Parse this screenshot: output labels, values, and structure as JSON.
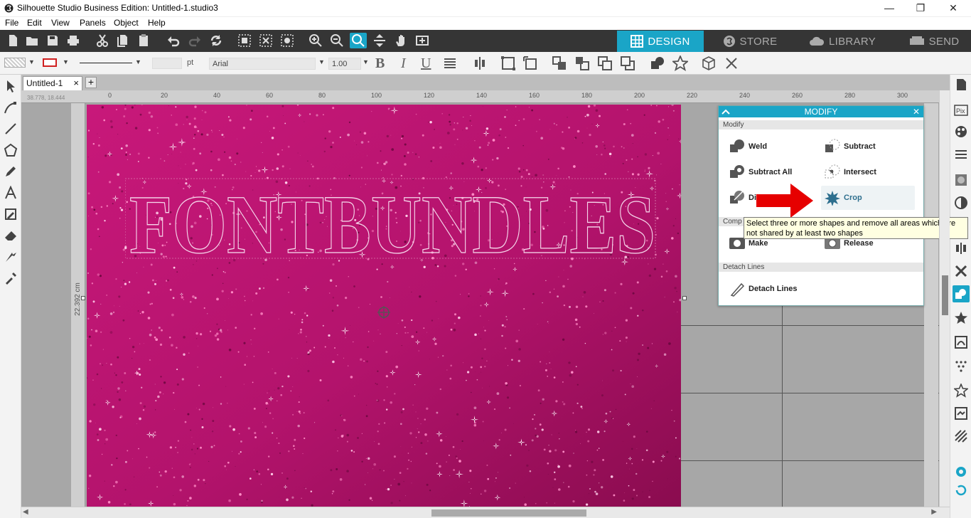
{
  "window": {
    "title": "Silhouette Studio Business Edition: Untitled-1.studio3",
    "minimize": "—",
    "restore": "❐",
    "close": "✕"
  },
  "menu": [
    "File",
    "Edit",
    "View",
    "Panels",
    "Object",
    "Help"
  ],
  "mode_tabs": [
    {
      "label": "DESIGN",
      "active": true
    },
    {
      "label": "STORE",
      "active": false
    },
    {
      "label": "LIBRARY",
      "active": false
    },
    {
      "label": "SEND",
      "active": false
    }
  ],
  "props_toolbar": {
    "line_unit": "pt",
    "font_name": "Arial",
    "font_size": "1.00",
    "bold": "B",
    "italic": "I",
    "underline": "U"
  },
  "document_tab": {
    "label": "Untitled-1",
    "close": "×",
    "add": "+"
  },
  "rulers": {
    "corner_readout": "38.778, 18.444",
    "h_ticks": [
      "0",
      "20",
      "40",
      "60",
      "80",
      "100",
      "120",
      "140",
      "160",
      "180",
      "200",
      "220",
      "240",
      "260",
      "280",
      "300"
    ],
    "v_label": "22.392 cm"
  },
  "canvas": {
    "text_outline": "FONTBUNDLES",
    "colors": {
      "base": "#b01268",
      "light": "#e0338f",
      "dark": "#7a0845"
    }
  },
  "modify_panel": {
    "title": "MODIFY",
    "close": "✕",
    "sections": {
      "modify": "Modify",
      "compound": "Comp",
      "detach": "Detach Lines"
    },
    "buttons": {
      "weld": "Weld",
      "subtract": "Subtract",
      "subtract_all": "Subtract All",
      "intersect": "Intersect",
      "divide": "Divi",
      "crop": "Crop",
      "make": "Make",
      "release": "Release",
      "detach_lines": "Detach Lines"
    }
  },
  "tooltip": "Select three or more shapes and remove all areas which are not shared by at least two shapes",
  "accent": "#1aa5c7",
  "arrow_color": "#e60000"
}
